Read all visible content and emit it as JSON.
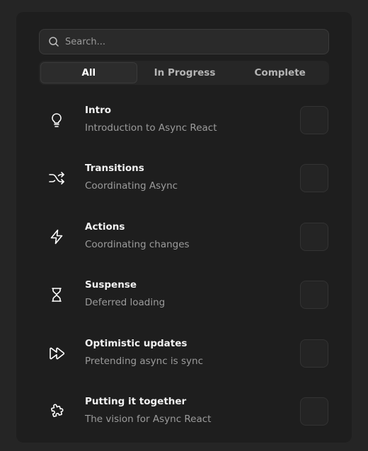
{
  "search": {
    "placeholder": "Search...",
    "value": ""
  },
  "tabs": [
    {
      "label": "All",
      "active": true
    },
    {
      "label": "In Progress",
      "active": false
    },
    {
      "label": "Complete",
      "active": false
    }
  ],
  "lessons": [
    {
      "title": "Intro",
      "subtitle": "Introduction to Async React",
      "icon": "lightbulb-icon",
      "checked": false
    },
    {
      "title": "Transitions",
      "subtitle": "Coordinating Async",
      "icon": "shuffle-icon",
      "checked": false
    },
    {
      "title": "Actions",
      "subtitle": "Coordinating changes",
      "icon": "lightning-icon",
      "checked": false
    },
    {
      "title": "Suspense",
      "subtitle": "Deferred loading",
      "icon": "hourglass-icon",
      "checked": false
    },
    {
      "title": "Optimistic updates",
      "subtitle": "Pretending async is sync",
      "icon": "fast-forward-icon",
      "checked": false
    },
    {
      "title": "Putting it together",
      "subtitle": "The vision for Async React",
      "icon": "puzzle-icon",
      "checked": false
    }
  ],
  "colors": {
    "page_bg": "#252525",
    "panel_bg": "#1e1e1e",
    "text_primary": "#f2f2f2",
    "text_secondary": "#9c9c9c"
  }
}
